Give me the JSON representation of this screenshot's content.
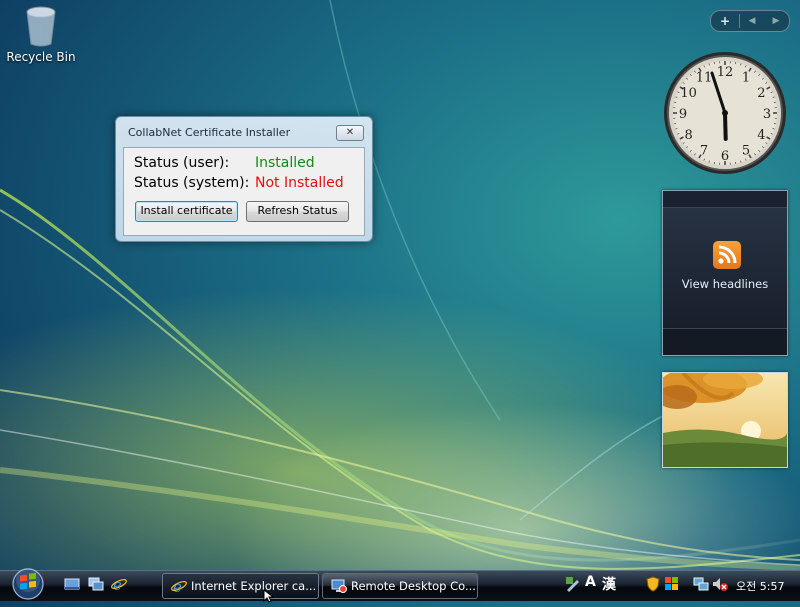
{
  "desktop": {
    "icons": [
      {
        "label": "Recycle Bin",
        "icon": "recycle-bin-icon"
      }
    ]
  },
  "sidebar": {
    "add_label": "+",
    "gadgets": {
      "clock": {
        "hour_numbers": [
          "12",
          "1",
          "2",
          "3",
          "4",
          "5",
          "6",
          "7",
          "8",
          "9",
          "10",
          "11"
        ],
        "hour": 5,
        "minute": 57
      },
      "feed": {
        "label": "View headlines",
        "icon": "rss-icon"
      },
      "slideshow": {
        "icon": "photo-icon"
      }
    }
  },
  "dialog": {
    "title": "CollabNet Certificate Installer",
    "close_label": "✕",
    "rows": [
      {
        "key": "Status (user):",
        "value": "Installed",
        "color": "#118a11"
      },
      {
        "key": "Status (system):",
        "value": "Not Installed",
        "color": "#e01010"
      }
    ],
    "buttons": {
      "install": "Install certificate",
      "refresh": "Refresh Status"
    }
  },
  "taskbar": {
    "tasks": [
      {
        "label": "Internet Explorer ca...",
        "icon": "ie-icon",
        "active": true
      },
      {
        "label": "Remote Desktop Co...",
        "icon": "remote-desktop-icon",
        "active": false
      }
    ],
    "tray": {
      "ime_mode": "A",
      "ime_hanja": "漢",
      "time": "오전 5:57"
    }
  }
}
